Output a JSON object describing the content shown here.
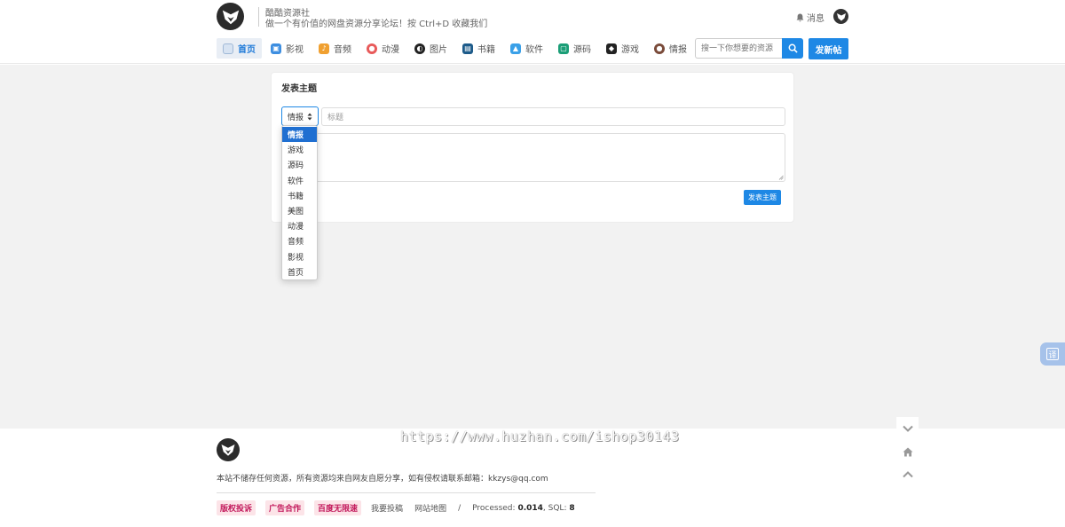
{
  "header": {
    "site_name": "酷酷资源社",
    "slogan": "做一个有价值的网盘资源分享论坛！按 Ctrl+D 收藏我们",
    "notifications_label": "消息"
  },
  "nav": {
    "items": [
      {
        "label": "首页",
        "icon": "home-icon",
        "color": "#7fa9d8"
      },
      {
        "label": "影视",
        "icon": "tv-icon",
        "color": "#3d8ee0"
      },
      {
        "label": "音频",
        "icon": "audio-icon",
        "color": "#f0a030"
      },
      {
        "label": "动漫",
        "icon": "anime-icon",
        "color": "#e85a5a"
      },
      {
        "label": "图片",
        "icon": "image-icon",
        "color": "#222222"
      },
      {
        "label": "书籍",
        "icon": "book-icon",
        "color": "#1d5b8a"
      },
      {
        "label": "软件",
        "icon": "software-icon",
        "color": "#3aa0e8"
      },
      {
        "label": "源码",
        "icon": "code-icon",
        "color": "#1b9e77"
      },
      {
        "label": "游戏",
        "icon": "game-icon",
        "color": "#222222"
      },
      {
        "label": "情报",
        "icon": "intel-icon",
        "color": "#7a4b3a"
      }
    ]
  },
  "search": {
    "placeholder": "搜一下你想要的资源"
  },
  "actions": {
    "post_label": "发新帖"
  },
  "form": {
    "heading": "发表主题",
    "category_value": "情报",
    "title_placeholder": "标题",
    "submit_label": "发表主题",
    "category_options": [
      "情报",
      "游戏",
      "源码",
      "软件",
      "书籍",
      "美图",
      "动漫",
      "音频",
      "影视",
      "首页"
    ]
  },
  "translate_label": "译",
  "footer": {
    "disclaimer": "本站不储存任何资源，所有资源均来自网友自愿分享，如有侵权请联系邮箱：kkzys@qq.com",
    "badges": [
      "版权投诉",
      "广告合作",
      "百度无限速"
    ],
    "links": [
      "我要投稿",
      "网站地图"
    ],
    "separator": "/",
    "processed_label": "Processed:",
    "processed_value": "0.014",
    "sql_label": ", SQL:",
    "sql_value": "8"
  },
  "watermark": "https://www.huzhan.com/ishop30143",
  "accent_color": "#1e88e5"
}
